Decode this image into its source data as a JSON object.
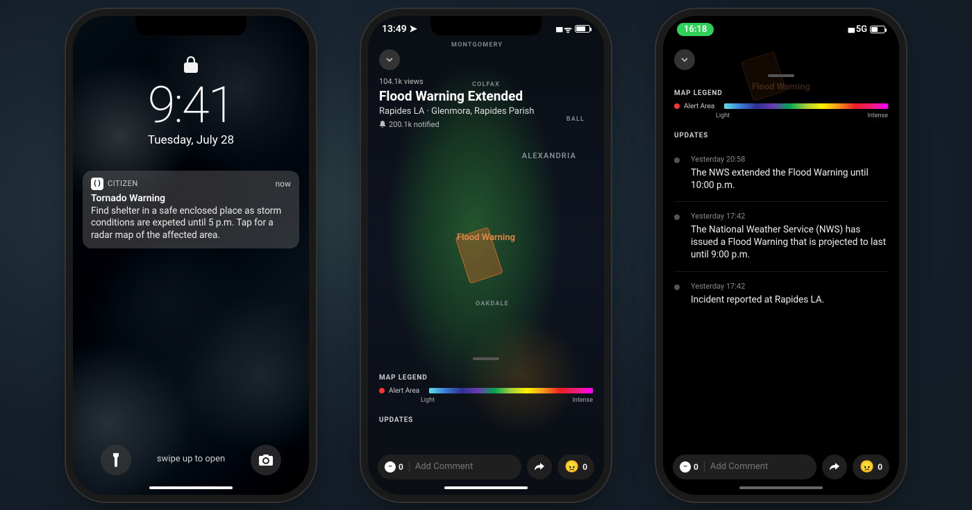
{
  "phone1": {
    "time": "9:41",
    "date": "Tuesday, July 28",
    "notification": {
      "app": "CITIZEN",
      "timestamp": "now",
      "title": "Tornado Warning",
      "body": "Find shelter in a safe enclosed place as storm conditions are expeted until 5 p.m. Tap for a radar map of the affected area."
    },
    "swipe_hint": "swipe up to open"
  },
  "phone2": {
    "status_time": "13:49",
    "views": "104.1k views",
    "title": "Flood Warning Extended",
    "location": "Rapides LA · Glenmora, Rapides Parish",
    "notified": "200.1k notified",
    "map_labels": {
      "montgomery": "MONTGOMERY",
      "colfax": "COLFAX",
      "ball": "BALL",
      "alexandria": "ALEXANDRIA",
      "oakdale": "OAKDALE"
    },
    "alert_label": "Flood Warning",
    "legend": {
      "title": "MAP LEGEND",
      "alert_area": "Alert Area",
      "light": "Light",
      "intense": "Intense"
    },
    "updates_title": "UPDATES",
    "comment_placeholder": "Add Comment",
    "comment_count": "0",
    "react_count": "0"
  },
  "phone3": {
    "status_time": "16:18",
    "network": "5G",
    "faint_alert": "Flood Warning",
    "legend": {
      "title": "MAP LEGEND",
      "alert_area": "Alert Area",
      "light": "Light",
      "intense": "Intense"
    },
    "updates_title": "UPDATES",
    "updates": [
      {
        "ts": "Yesterday 20:58",
        "text": "The NWS extended the Flood Warning until 10:00 p.m."
      },
      {
        "ts": "Yesterday 17:42",
        "text": "The National Weather Service (NWS) has issued a Flood Warning that is projected to last until 9:00 p.m."
      },
      {
        "ts": "Yesterday 17:42",
        "text": "Incident reported at Rapides LA."
      }
    ],
    "comment_placeholder": "Add Comment",
    "comment_count": "0",
    "react_count": "0"
  }
}
